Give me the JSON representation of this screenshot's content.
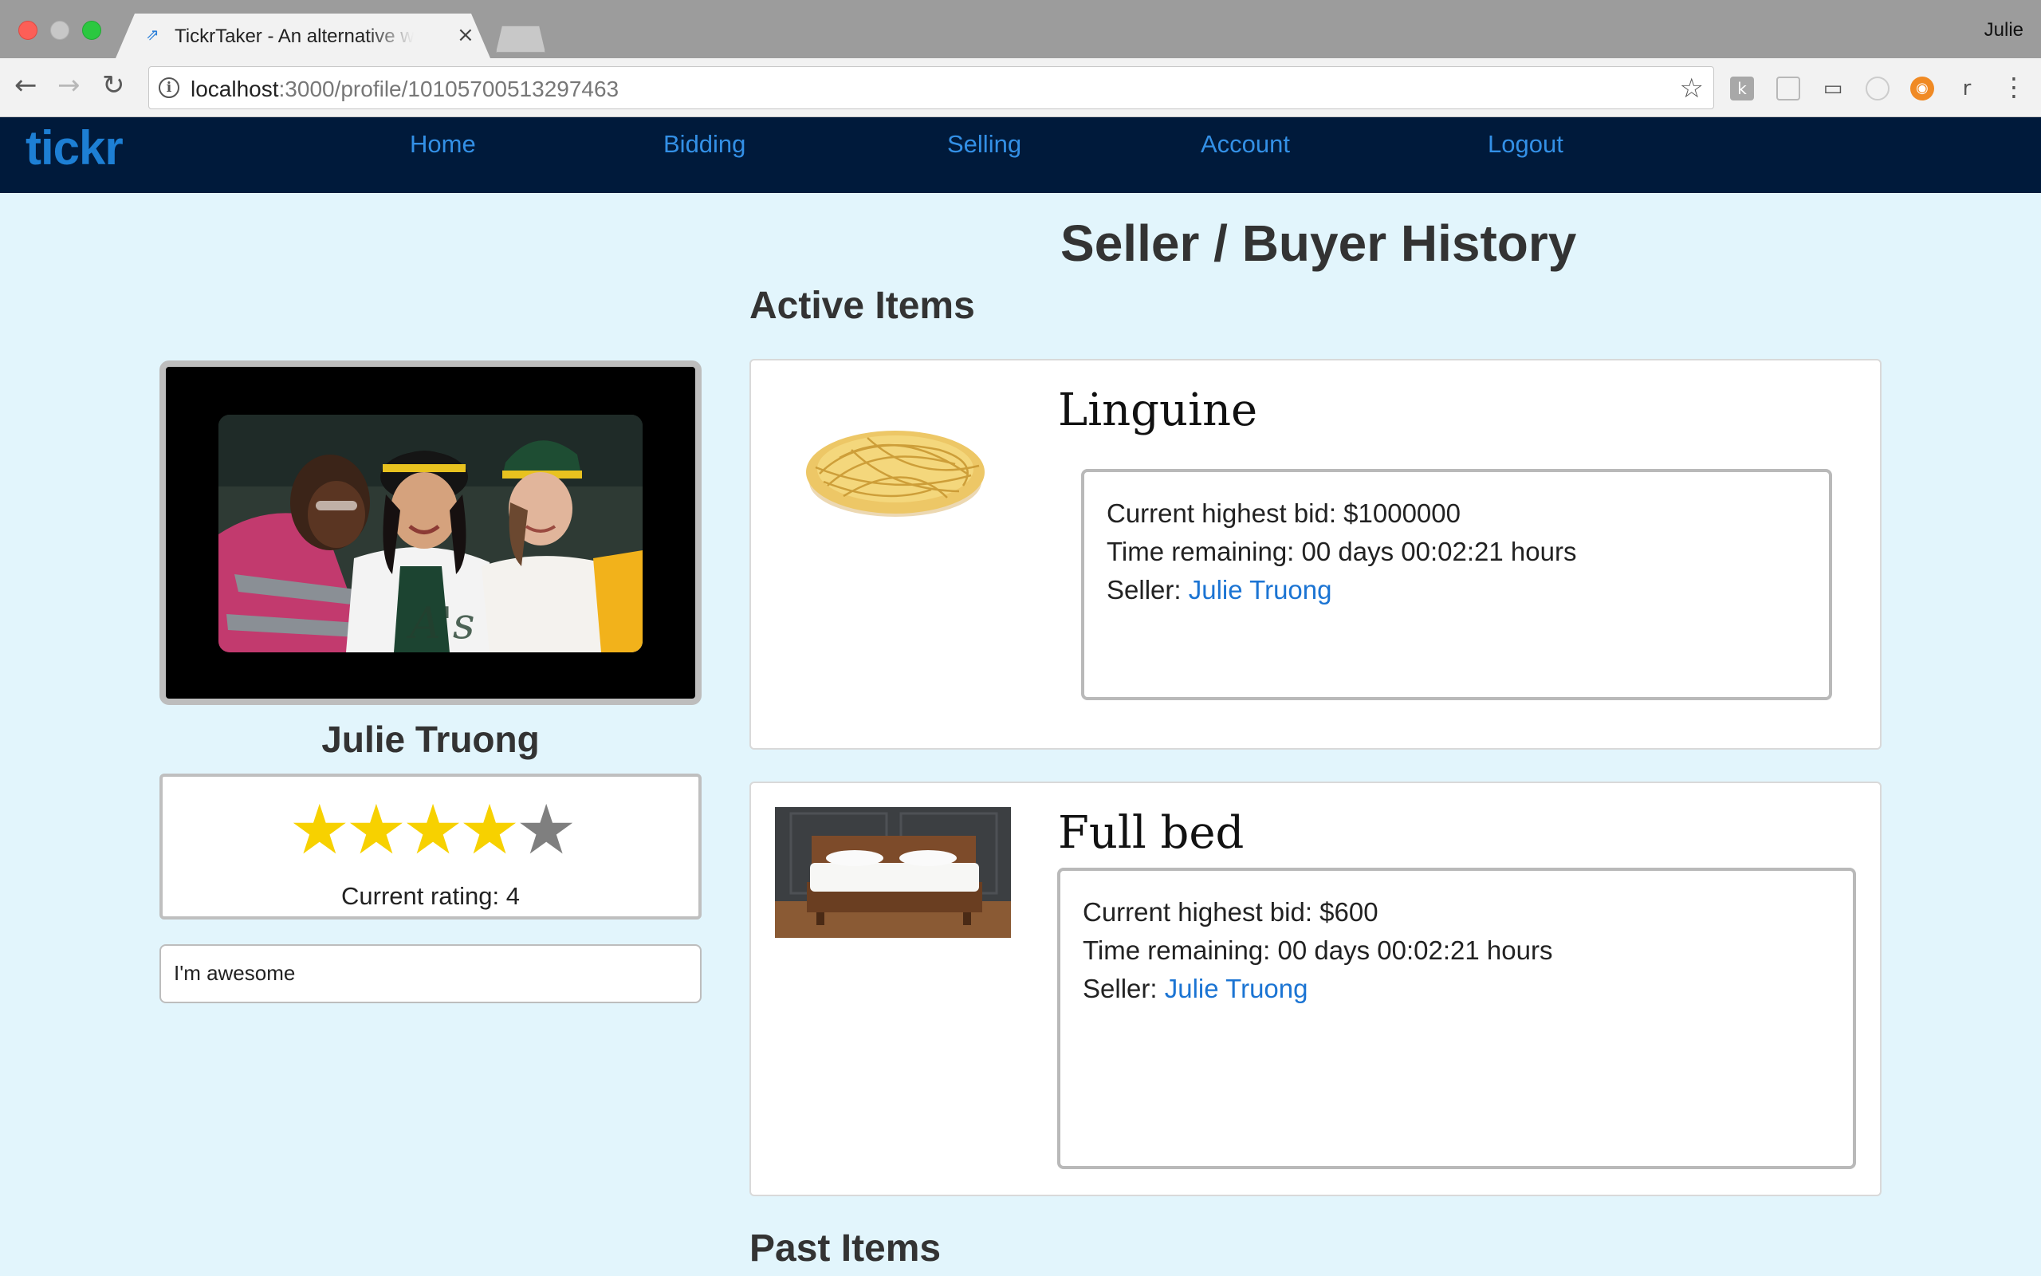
{
  "browser": {
    "tab_title": "TickrTaker - An alternative way to shop",
    "tab_close": "×",
    "tab_favicon": "⇗",
    "profile_name": "Julie",
    "url_host": "localhost",
    "url_path": ":3000/profile/10105700513297463",
    "nav": {
      "back": "←",
      "forward": "→",
      "reload": "↻"
    },
    "info_icon": "i",
    "star_icon": "☆",
    "extensions": [
      "k",
      "",
      "▭",
      "",
      "◉",
      "r"
    ],
    "menu_icon": "⋮"
  },
  "sitenav": {
    "brand": "tickr",
    "links": [
      "Home",
      "Bidding",
      "Selling",
      "Account",
      "Logout"
    ]
  },
  "page": {
    "title": "Seller / Buyer History",
    "active_heading": "Active Items",
    "past_heading": "Past Items"
  },
  "profile": {
    "name": "Julie Truong",
    "rating": 4,
    "rating_max": 5,
    "rating_text": "Current rating: 4",
    "bio": "I'm awesome",
    "colors": {
      "star_on": "#f7d100",
      "star_off": "#7f7f7f"
    }
  },
  "items": [
    {
      "title": "Linguine",
      "bid_line": "Current highest bid: $1000000",
      "time_line": "Time remaining: 00 days 00:02:21 hours",
      "seller_label": "Seller: ",
      "seller_name": "Julie Truong"
    },
    {
      "title": "Full bed",
      "bid_line": "Current highest bid: $600",
      "time_line": "Time remaining: 00 days 00:02:21 hours",
      "seller_label": "Seller: ",
      "seller_name": "Julie Truong"
    }
  ],
  "colors": {
    "page_bg": "#e2f5fc",
    "nav_bg": "#001a3b",
    "nav_link": "#3390e6",
    "brand": "#1d7fd4",
    "link": "#1b74d3"
  }
}
